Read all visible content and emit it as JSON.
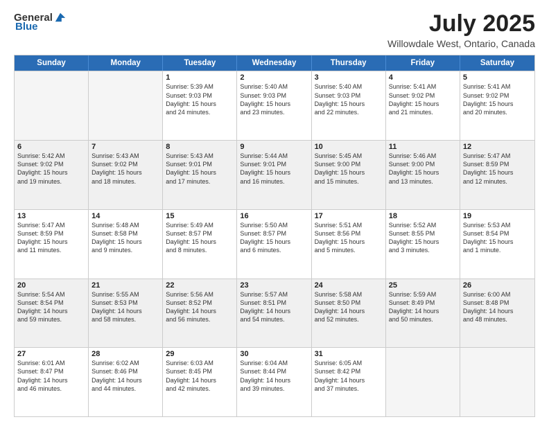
{
  "logo": {
    "general": "General",
    "blue": "Blue"
  },
  "title": "July 2025",
  "subtitle": "Willowdale West, Ontario, Canada",
  "calendar": {
    "headers": [
      "Sunday",
      "Monday",
      "Tuesday",
      "Wednesday",
      "Thursday",
      "Friday",
      "Saturday"
    ],
    "rows": [
      [
        {
          "day": "",
          "lines": [],
          "empty": true
        },
        {
          "day": "",
          "lines": [],
          "empty": true
        },
        {
          "day": "1",
          "lines": [
            "Sunrise: 5:39 AM",
            "Sunset: 9:03 PM",
            "Daylight: 15 hours",
            "and 24 minutes."
          ]
        },
        {
          "day": "2",
          "lines": [
            "Sunrise: 5:40 AM",
            "Sunset: 9:03 PM",
            "Daylight: 15 hours",
            "and 23 minutes."
          ]
        },
        {
          "day": "3",
          "lines": [
            "Sunrise: 5:40 AM",
            "Sunset: 9:03 PM",
            "Daylight: 15 hours",
            "and 22 minutes."
          ]
        },
        {
          "day": "4",
          "lines": [
            "Sunrise: 5:41 AM",
            "Sunset: 9:02 PM",
            "Daylight: 15 hours",
            "and 21 minutes."
          ]
        },
        {
          "day": "5",
          "lines": [
            "Sunrise: 5:41 AM",
            "Sunset: 9:02 PM",
            "Daylight: 15 hours",
            "and 20 minutes."
          ]
        }
      ],
      [
        {
          "day": "6",
          "lines": [
            "Sunrise: 5:42 AM",
            "Sunset: 9:02 PM",
            "Daylight: 15 hours",
            "and 19 minutes."
          ],
          "shaded": true
        },
        {
          "day": "7",
          "lines": [
            "Sunrise: 5:43 AM",
            "Sunset: 9:02 PM",
            "Daylight: 15 hours",
            "and 18 minutes."
          ],
          "shaded": true
        },
        {
          "day": "8",
          "lines": [
            "Sunrise: 5:43 AM",
            "Sunset: 9:01 PM",
            "Daylight: 15 hours",
            "and 17 minutes."
          ],
          "shaded": true
        },
        {
          "day": "9",
          "lines": [
            "Sunrise: 5:44 AM",
            "Sunset: 9:01 PM",
            "Daylight: 15 hours",
            "and 16 minutes."
          ],
          "shaded": true
        },
        {
          "day": "10",
          "lines": [
            "Sunrise: 5:45 AM",
            "Sunset: 9:00 PM",
            "Daylight: 15 hours",
            "and 15 minutes."
          ],
          "shaded": true
        },
        {
          "day": "11",
          "lines": [
            "Sunrise: 5:46 AM",
            "Sunset: 9:00 PM",
            "Daylight: 15 hours",
            "and 13 minutes."
          ],
          "shaded": true
        },
        {
          "day": "12",
          "lines": [
            "Sunrise: 5:47 AM",
            "Sunset: 8:59 PM",
            "Daylight: 15 hours",
            "and 12 minutes."
          ],
          "shaded": true
        }
      ],
      [
        {
          "day": "13",
          "lines": [
            "Sunrise: 5:47 AM",
            "Sunset: 8:59 PM",
            "Daylight: 15 hours",
            "and 11 minutes."
          ]
        },
        {
          "day": "14",
          "lines": [
            "Sunrise: 5:48 AM",
            "Sunset: 8:58 PM",
            "Daylight: 15 hours",
            "and 9 minutes."
          ]
        },
        {
          "day": "15",
          "lines": [
            "Sunrise: 5:49 AM",
            "Sunset: 8:57 PM",
            "Daylight: 15 hours",
            "and 8 minutes."
          ]
        },
        {
          "day": "16",
          "lines": [
            "Sunrise: 5:50 AM",
            "Sunset: 8:57 PM",
            "Daylight: 15 hours",
            "and 6 minutes."
          ]
        },
        {
          "day": "17",
          "lines": [
            "Sunrise: 5:51 AM",
            "Sunset: 8:56 PM",
            "Daylight: 15 hours",
            "and 5 minutes."
          ]
        },
        {
          "day": "18",
          "lines": [
            "Sunrise: 5:52 AM",
            "Sunset: 8:55 PM",
            "Daylight: 15 hours",
            "and 3 minutes."
          ]
        },
        {
          "day": "19",
          "lines": [
            "Sunrise: 5:53 AM",
            "Sunset: 8:54 PM",
            "Daylight: 15 hours",
            "and 1 minute."
          ]
        }
      ],
      [
        {
          "day": "20",
          "lines": [
            "Sunrise: 5:54 AM",
            "Sunset: 8:54 PM",
            "Daylight: 14 hours",
            "and 59 minutes."
          ],
          "shaded": true
        },
        {
          "day": "21",
          "lines": [
            "Sunrise: 5:55 AM",
            "Sunset: 8:53 PM",
            "Daylight: 14 hours",
            "and 58 minutes."
          ],
          "shaded": true
        },
        {
          "day": "22",
          "lines": [
            "Sunrise: 5:56 AM",
            "Sunset: 8:52 PM",
            "Daylight: 14 hours",
            "and 56 minutes."
          ],
          "shaded": true
        },
        {
          "day": "23",
          "lines": [
            "Sunrise: 5:57 AM",
            "Sunset: 8:51 PM",
            "Daylight: 14 hours",
            "and 54 minutes."
          ],
          "shaded": true
        },
        {
          "day": "24",
          "lines": [
            "Sunrise: 5:58 AM",
            "Sunset: 8:50 PM",
            "Daylight: 14 hours",
            "and 52 minutes."
          ],
          "shaded": true
        },
        {
          "day": "25",
          "lines": [
            "Sunrise: 5:59 AM",
            "Sunset: 8:49 PM",
            "Daylight: 14 hours",
            "and 50 minutes."
          ],
          "shaded": true
        },
        {
          "day": "26",
          "lines": [
            "Sunrise: 6:00 AM",
            "Sunset: 8:48 PM",
            "Daylight: 14 hours",
            "and 48 minutes."
          ],
          "shaded": true
        }
      ],
      [
        {
          "day": "27",
          "lines": [
            "Sunrise: 6:01 AM",
            "Sunset: 8:47 PM",
            "Daylight: 14 hours",
            "and 46 minutes."
          ]
        },
        {
          "day": "28",
          "lines": [
            "Sunrise: 6:02 AM",
            "Sunset: 8:46 PM",
            "Daylight: 14 hours",
            "and 44 minutes."
          ]
        },
        {
          "day": "29",
          "lines": [
            "Sunrise: 6:03 AM",
            "Sunset: 8:45 PM",
            "Daylight: 14 hours",
            "and 42 minutes."
          ]
        },
        {
          "day": "30",
          "lines": [
            "Sunrise: 6:04 AM",
            "Sunset: 8:44 PM",
            "Daylight: 14 hours",
            "and 39 minutes."
          ]
        },
        {
          "day": "31",
          "lines": [
            "Sunrise: 6:05 AM",
            "Sunset: 8:42 PM",
            "Daylight: 14 hours",
            "and 37 minutes."
          ]
        },
        {
          "day": "",
          "lines": [],
          "empty": true
        },
        {
          "day": "",
          "lines": [],
          "empty": true
        }
      ]
    ]
  }
}
